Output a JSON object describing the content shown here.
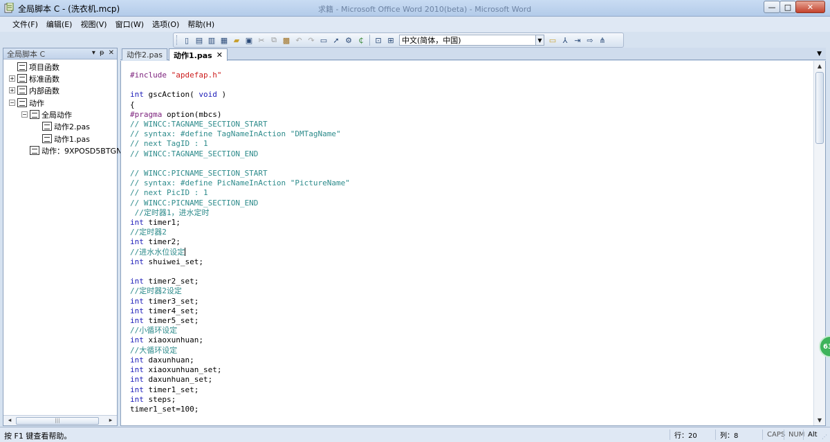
{
  "window": {
    "title": "全局脚本 C - (洗衣机.mcp)",
    "background_title": "求籍 - Microsoft Office Word 2010(beta) - Microsoft Word",
    "min_icon": "minimize-icon",
    "max_icon": "maximize-icon",
    "close_icon": "close-icon"
  },
  "menu": {
    "items": [
      "文件(F)",
      "编辑(E)",
      "视图(V)",
      "窗口(W)",
      "选项(O)",
      "帮助(H)"
    ]
  },
  "toolbar": {
    "language": "中文(简体，中国)"
  },
  "left_panel": {
    "title": "全局脚本 C",
    "header_buttons": [
      "▾",
      "ᵽ",
      "✕"
    ],
    "tree": [
      {
        "label": "项目函数",
        "expander": ""
      },
      {
        "label": "标准函数",
        "expander": "+"
      },
      {
        "label": "内部函数",
        "expander": "+"
      },
      {
        "label": "动作",
        "expander": "−"
      },
      {
        "label": "全局动作",
        "expander": "−"
      },
      {
        "label": "动作2.pas",
        "expander": ""
      },
      {
        "label": "动作1.pas",
        "expander": ""
      },
      {
        "label": "动作：9XPOSD5BTGN",
        "expander": ""
      }
    ]
  },
  "tabs": [
    {
      "label": "动作2.pas"
    },
    {
      "label": "动作1.pas",
      "close": "✕"
    }
  ],
  "editor": {
    "lines": [
      {
        "t": "pp",
        "v": "#include ",
        "s": "\"apdefap.h\""
      },
      {
        "t": "blank"
      },
      {
        "t": "fn",
        "v": "int gscAction( void )"
      },
      {
        "t": "id",
        "v": "{"
      },
      {
        "t": "pragma",
        "v": "#pragma option(mbcs)"
      },
      {
        "t": "cm",
        "v": "// WINCC:TAGNAME_SECTION_START"
      },
      {
        "t": "cm",
        "v": "// syntax: #define TagNameInAction \"DMTagName\""
      },
      {
        "t": "cm",
        "v": "// next TagID : 1"
      },
      {
        "t": "cm",
        "v": "// WINCC:TAGNAME_SECTION_END"
      },
      {
        "t": "blank"
      },
      {
        "t": "cm",
        "v": "// WINCC:PICNAME_SECTION_START"
      },
      {
        "t": "cm",
        "v": "// syntax: #define PicNameInAction \"PictureName\""
      },
      {
        "t": "cm",
        "v": "// next PicID : 1"
      },
      {
        "t": "cm",
        "v": "// WINCC:PICNAME_SECTION_END"
      },
      {
        "t": "cm",
        "v": " //定时器1，进水定时"
      },
      {
        "t": "int",
        "v": "timer1;"
      },
      {
        "t": "cm",
        "v": "//定时器2"
      },
      {
        "t": "int",
        "v": "timer2;"
      },
      {
        "t": "cmcaret",
        "v": "//进水水位设定"
      },
      {
        "t": "int",
        "v": "shuiwei_set;"
      },
      {
        "t": "blank"
      },
      {
        "t": "int",
        "v": "timer2_set;"
      },
      {
        "t": "cm",
        "v": "//定时器2设定"
      },
      {
        "t": "int",
        "v": "timer3_set;"
      },
      {
        "t": "int",
        "v": "timer4_set;"
      },
      {
        "t": "int",
        "v": "timer5_set;"
      },
      {
        "t": "cm",
        "v": "//小循环设定"
      },
      {
        "t": "int",
        "v": "xiaoxunhuan;"
      },
      {
        "t": "cm",
        "v": "//大循环设定"
      },
      {
        "t": "int",
        "v": "daxunhuan;"
      },
      {
        "t": "int",
        "v": "xiaoxunhuan_set;"
      },
      {
        "t": "int",
        "v": "daxunhuan_set;"
      },
      {
        "t": "int",
        "v": "timer1_set;"
      },
      {
        "t": "int",
        "v": "steps;"
      },
      {
        "t": "id",
        "v": "timer1_set=100;"
      }
    ]
  },
  "badge": "63",
  "status": {
    "message": "按 F1 键查看帮助。",
    "row": "行：20",
    "col": "列：8",
    "caps": "CAPS",
    "num": "NUM",
    "alt": "Alt"
  },
  "colors": {
    "keyword": "#1b1bb8",
    "string": "#cc1b1b",
    "comment": "#2d8b8b",
    "preprocessor": "#7b1f7b"
  }
}
